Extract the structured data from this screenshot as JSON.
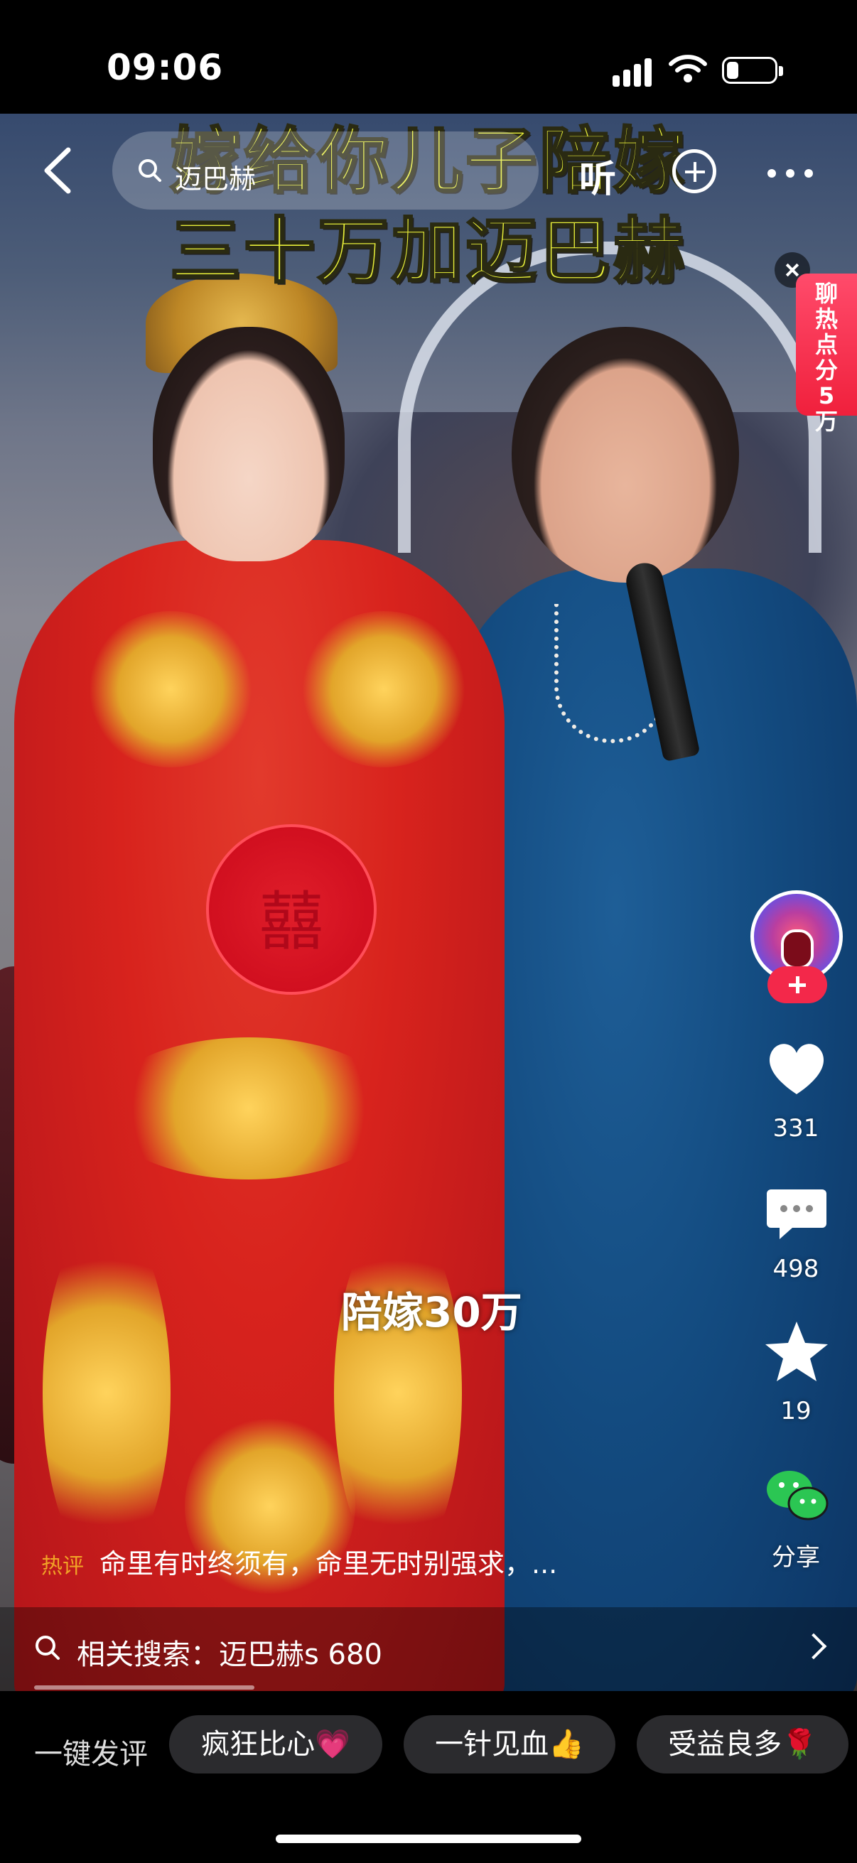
{
  "status_bar": {
    "time": "09:06"
  },
  "top_nav": {
    "search_text": "迈巴赫",
    "listen_label": "听"
  },
  "video": {
    "caption_line1": "嫁给你儿子陪嫁",
    "caption_line2": "三十万加迈巴赫",
    "overlay_label": "陪嫁30万"
  },
  "hot_topic": {
    "text": "聊热点分5万"
  },
  "actions": {
    "likes": "331",
    "comments": "498",
    "favorites": "19",
    "share": "分享"
  },
  "hot_comment": {
    "tag": "热评",
    "text": "命里有时终须有，命里无时别强求，..."
  },
  "related_search": {
    "text": "相关搜索：迈巴赫s 680"
  },
  "quick_comments": {
    "label": "一键发评",
    "chips": [
      "疯狂比心💗",
      "一针见血👍",
      "受益良多🌹"
    ]
  },
  "colors": {
    "caption_yellow": "#e8ef3a",
    "follow_red": "#f3284a",
    "hot_tag": "#f1a326"
  }
}
